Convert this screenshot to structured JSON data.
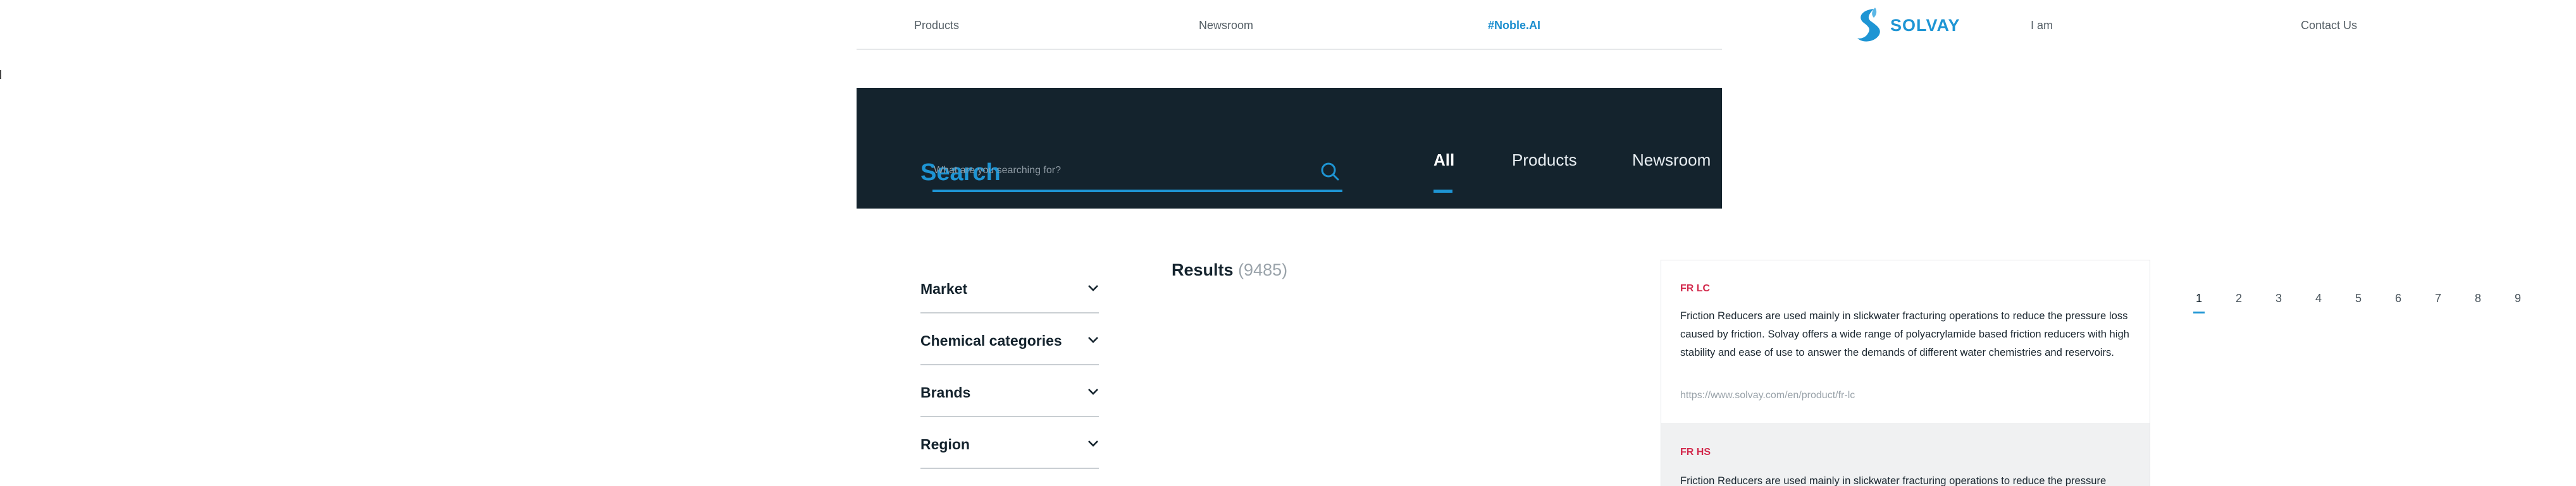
{
  "nav": {
    "items": [
      "Products",
      "Newsroom",
      "#Noble.AI",
      "I am",
      "Contact Us"
    ],
    "logo_text": "SOLVAY",
    "accent_color": "#1e8fcf"
  },
  "search": {
    "title": "Search",
    "placeholder": "What are you searching for?",
    "tabs": [
      "All",
      "Products",
      "Newsroom"
    ],
    "active_tab": "All",
    "band_color": "#14232d"
  },
  "filters": [
    "Market",
    "Chemical categories",
    "Brands",
    "Region"
  ],
  "results": {
    "label": "Results",
    "count": "(9485)",
    "items": [
      {
        "title": "FR LC",
        "description": "Friction Reducers are used mainly in slickwater fracturing operations to reduce the pressure loss caused by friction. Solvay offers a wide range of polyacrylamide based friction reducers with high stability and ease of use to answer the demands of different water chemistries and reservoirs.",
        "url": "https://www.solvay.com/en/product/fr-lc"
      },
      {
        "title": "FR HS",
        "description": "Friction Reducers are used mainly in slickwater fracturing operations to reduce the pressure"
      }
    ],
    "title_color": "#d2284b"
  },
  "pagination": {
    "pages": [
      "1",
      "2",
      "3",
      "4",
      "5",
      "6",
      "7",
      "8",
      "9"
    ],
    "current": "1"
  }
}
